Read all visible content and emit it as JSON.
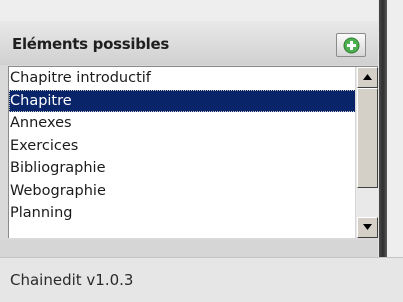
{
  "panel": {
    "title": "Eléments possibles",
    "add_button_icon": "plus-circle-icon",
    "items": [
      {
        "label": "Chapitre introductif",
        "selected": false
      },
      {
        "label": "Chapitre",
        "selected": true
      },
      {
        "label": "Annexes",
        "selected": false
      },
      {
        "label": "Exercices",
        "selected": false
      },
      {
        "label": "Bibliographie",
        "selected": false
      },
      {
        "label": "Webographie",
        "selected": false
      },
      {
        "label": "Planning",
        "selected": false
      }
    ]
  },
  "status_bar": {
    "version": "Chainedit v1.0.3"
  },
  "colors": {
    "selection": "#0a246a",
    "add_icon": "#4caf50"
  }
}
